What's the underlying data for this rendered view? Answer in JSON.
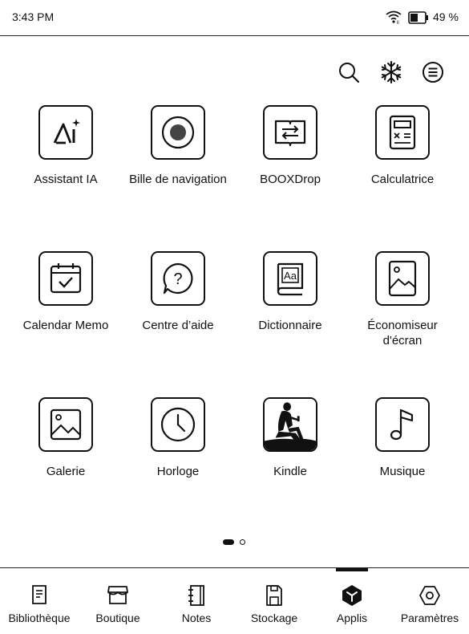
{
  "status": {
    "time": "3:43 PM",
    "battery_text": "49 %"
  },
  "toolbar": {
    "icons": [
      "search-icon",
      "snowflake-icon",
      "menu-icon"
    ]
  },
  "apps": [
    {
      "label": "Assistant IA",
      "icon": "ai-assistant-icon"
    },
    {
      "label": "Bille de navigation",
      "icon": "nav-ball-icon"
    },
    {
      "label": "BOOXDrop",
      "icon": "booxdrop-icon"
    },
    {
      "label": "Calculatrice",
      "icon": "calculator-icon"
    },
    {
      "label": "Calendar Memo",
      "icon": "calendar-icon"
    },
    {
      "label": "Centre d’aide",
      "icon": "help-icon"
    },
    {
      "label": "Dictionnaire",
      "icon": "dictionary-icon"
    },
    {
      "label": "Économiseur\nd'écran",
      "icon": "screensaver-icon"
    },
    {
      "label": "Galerie",
      "icon": "gallery-icon"
    },
    {
      "label": "Horloge",
      "icon": "clock-icon"
    },
    {
      "label": "Kindle",
      "icon": "kindle-icon"
    },
    {
      "label": "Musique",
      "icon": "music-icon"
    }
  ],
  "pager": {
    "current_page": 1,
    "total_pages": 2
  },
  "nav": {
    "items": [
      {
        "label": "Bibliothèque",
        "icon": "library-icon"
      },
      {
        "label": "Boutique",
        "icon": "shop-icon"
      },
      {
        "label": "Notes",
        "icon": "notes-icon"
      },
      {
        "label": "Stockage",
        "icon": "storage-icon"
      },
      {
        "label": "Applis",
        "icon": "apps-icon",
        "active": true
      },
      {
        "label": "Paramètres",
        "icon": "settings-icon"
      }
    ]
  }
}
